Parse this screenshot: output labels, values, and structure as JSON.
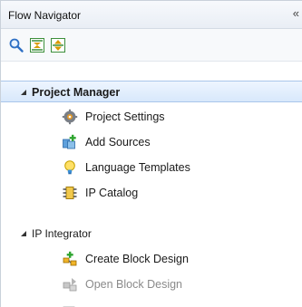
{
  "panel": {
    "title": "Flow Navigator",
    "collapse_glyph": "«"
  },
  "toolbar": {
    "buttons": [
      {
        "icon": "search-icon"
      },
      {
        "icon": "collapse-all-icon"
      },
      {
        "icon": "expand-all-icon"
      }
    ]
  },
  "sections": [
    {
      "label": "Project Manager",
      "expanded": true,
      "selected": true,
      "items": [
        {
          "label": "Project Settings",
          "icon": "gear-icon",
          "enabled": true
        },
        {
          "label": "Add Sources",
          "icon": "add-sources-icon",
          "enabled": true
        },
        {
          "label": "Language Templates",
          "icon": "lightbulb-icon",
          "enabled": true
        },
        {
          "label": "IP Catalog",
          "icon": "chip-icon",
          "enabled": true
        }
      ]
    },
    {
      "label": "IP Integrator",
      "expanded": true,
      "selected": false,
      "items": [
        {
          "label": "Create Block Design",
          "icon": "create-block-design-icon",
          "enabled": true
        },
        {
          "label": "Open Block Design",
          "icon": "open-block-design-icon",
          "enabled": false
        },
        {
          "label": "",
          "icon": "generate-block-design-icon",
          "enabled": false
        }
      ]
    }
  ],
  "colors": {
    "selection_bg": "#d8e8fb",
    "selection_border": "#a9c6ea",
    "disabled_text": "#8a8a8a"
  }
}
